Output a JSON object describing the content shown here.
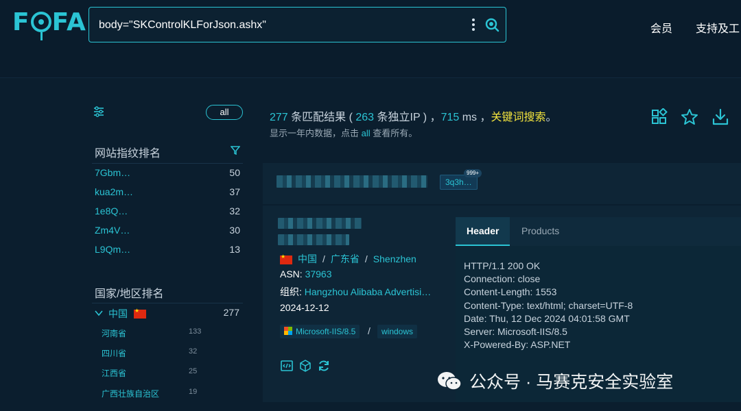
{
  "header": {
    "logo": "FOFA",
    "search_value": "body=\"SKControlKLForJson.ashx\"",
    "nav": [
      "会员",
      "支持及工"
    ]
  },
  "sidebar": {
    "all_label": "all",
    "fingerprint_title": "网站指纹排名",
    "fingerprints": [
      {
        "label": "7Gbm…",
        "count": "50"
      },
      {
        "label": "kua2m…",
        "count": "37"
      },
      {
        "label": "1e8Q…",
        "count": "32"
      },
      {
        "label": "Zm4V…",
        "count": "30"
      },
      {
        "label": "L9Qm…",
        "count": "13"
      }
    ],
    "country_title": "国家/地区排名",
    "country": {
      "name": "中国",
      "count": "277"
    },
    "provinces": [
      {
        "name": "河南省",
        "count": "133"
      },
      {
        "name": "四川省",
        "count": "32"
      },
      {
        "name": "江西省",
        "count": "25"
      },
      {
        "name": "广西壮族自治区",
        "count": "19"
      }
    ]
  },
  "summary": {
    "results": "277",
    "results_label": " 条匹配结果 ( ",
    "ips": "263",
    "ips_label": " 条独立IP ) ，",
    "ms": "715",
    "ms_label": " ms ，",
    "keyword": "关键词搜索",
    "end": "。",
    "sub_prefix": "显示一年内数据，点击 ",
    "sub_all": "all",
    "sub_suffix": " 查看所有。"
  },
  "result1": {
    "host_tag": "3q3h…",
    "badge": "999+"
  },
  "result2": {
    "country": "中国",
    "province": "广东省",
    "city": "Shenzhen",
    "asn_label": "ASN: ",
    "asn": "37963",
    "org_label": "组织: ",
    "org": "Hangzhou Alibaba Adverti­si…",
    "date": "2024-12-12",
    "tag1": "Microsoft-IIS/8.5",
    "slash": "/",
    "tag2": "windows",
    "tabs": [
      "Header",
      "Products"
    ],
    "header_text": "HTTP/1.1 200 OK\nConnection: close\nContent-Length: 1553\nContent-Type: text/html; charset=UTF-8\nDate: Thu, 12 Dec 2024 04:01:58 GMT\nServer: Microsoft-IIS/8.5\nX-Powered-By: ASP.NET"
  },
  "watermark": "公众号 · 马赛克安全实验室",
  "colors": {
    "accent": "#2bc4d4",
    "keyword": "#f2e33d",
    "background": "#0b1e2e"
  }
}
